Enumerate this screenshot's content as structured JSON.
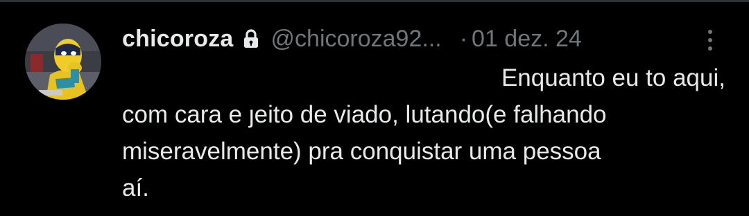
{
  "tweet": {
    "display_name": "chicoroza",
    "handle": "@chicoroza92...",
    "separator": "·",
    "date": "01 dez. 24",
    "lock_icon": "lock-icon",
    "more_icon": "more-vertical-icon",
    "text_lines": [
      "Enquanto eu to aqui,",
      "com cara e ȷeito de viado, lutando(e falhando",
      "miseravelmente) pra conquistar uma pessoa",
      "aí."
    ]
  },
  "colors": {
    "background": "#000000",
    "primary_text": "#e7e9ea",
    "secondary_text": "#71767b",
    "divider": "#2f3336"
  }
}
